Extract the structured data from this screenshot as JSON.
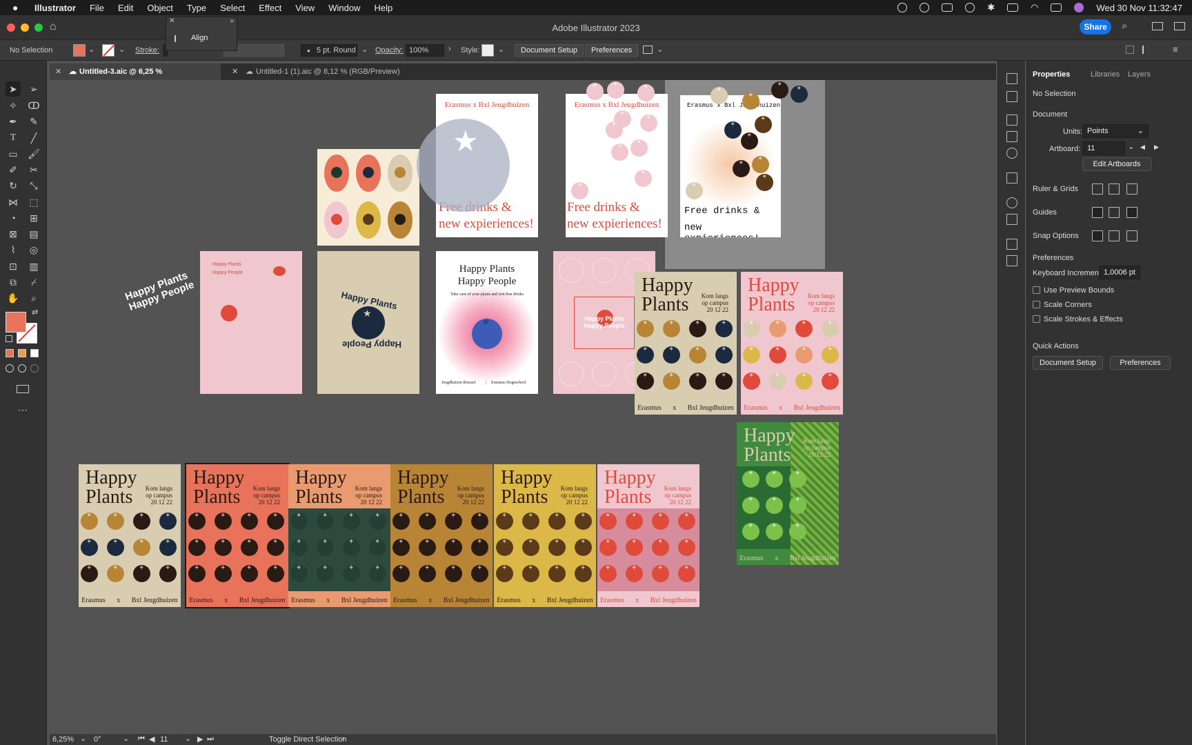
{
  "menubar": {
    "app": "Illustrator",
    "items": [
      "File",
      "Edit",
      "Object",
      "Type",
      "Select",
      "Effect",
      "View",
      "Window",
      "Help"
    ],
    "clock": "Wed 30 Nov  11:32:47"
  },
  "titlebar": {
    "title": "Adobe Illustrator 2023",
    "share": "Share"
  },
  "align_popup": {
    "label": "Align"
  },
  "controlbar": {
    "selection": "No Selection",
    "stroke_label": "Stroke:",
    "brush": "5 pt. Round",
    "opacity_label": "Opacity:",
    "opacity_value": "100%",
    "style_label": "Style:",
    "document_setup": "Document Setup",
    "preferences": "Preferences",
    "fill_color": "#e8735a"
  },
  "tabs": [
    {
      "label": "Untitled-3.aic @ 6,25 % (CMYK/Preview)",
      "active": true
    },
    {
      "label": "Untitled-1 (1).aic @ 8,12 % (RGB/Preview)",
      "active": false
    }
  ],
  "statusbar": {
    "zoom": "6,25%",
    "rotation": "0°",
    "artboard": "11",
    "hint": "Toggle Direct Selection"
  },
  "panel": {
    "tabs": [
      "Properties",
      "Libraries",
      "Layers"
    ],
    "selection": "No Selection",
    "document_heading": "Document",
    "units_label": "Units:",
    "units_value": "Points",
    "artboard_label": "Artboard:",
    "artboard_value": "11",
    "edit_artboards": "Edit Artboards",
    "ruler_grids": "Ruler & Grids",
    "guides": "Guides",
    "snap_options": "Snap Options",
    "preferences_heading": "Preferences",
    "keyboard_increment_label": "Keyboard Increment:",
    "keyboard_increment_value": "1,0006 pt",
    "checkboxes": [
      "Use Preview Bounds",
      "Scale Corners",
      "Scale Strokes & Effects"
    ],
    "quick_actions": "Quick Actions",
    "document_setup_btn": "Document Setup",
    "preferences_btn": "Preferences"
  },
  "artwork": {
    "erasmus_header": "Erasmus x Bxl Jeugdhuizen",
    "free_drinks_1": "Free drinks &",
    "free_drinks_2": "new expieriences!",
    "happy": "Happy",
    "plants": "Plants",
    "happy_plants": "Happy Plants",
    "happy_people": "Happy People",
    "kom_langs_1": "Kom langs",
    "kom_langs_2": "op campus",
    "kom_langs_3": "20 12 22",
    "kom_langs_date_green": "20/12/22",
    "footer_erasmus": "Erasmus",
    "footer_x": "x",
    "footer_bxl": "Bxl Jeugdhuizen",
    "take_care": "Take care of your plants and win free drinks",
    "foot_jeugdhuizen": "Jeugdhuizen Brussel",
    "foot_hogeschool": "Erasmus Hogeschool",
    "foot_sep": "|",
    "sticker_text": "Happy Plants Happy People",
    "colors": {
      "cream": "#d8cdb0",
      "coral": "#e8735a",
      "peach": "#e99a6e",
      "ochre": "#b88436",
      "mustard": "#dcb848",
      "pink": "#f1c7cf",
      "green": "#3f8a3e",
      "dark": "#2a1a14",
      "navy": "#1b2a3e",
      "red_text": "#e04a3a"
    }
  }
}
